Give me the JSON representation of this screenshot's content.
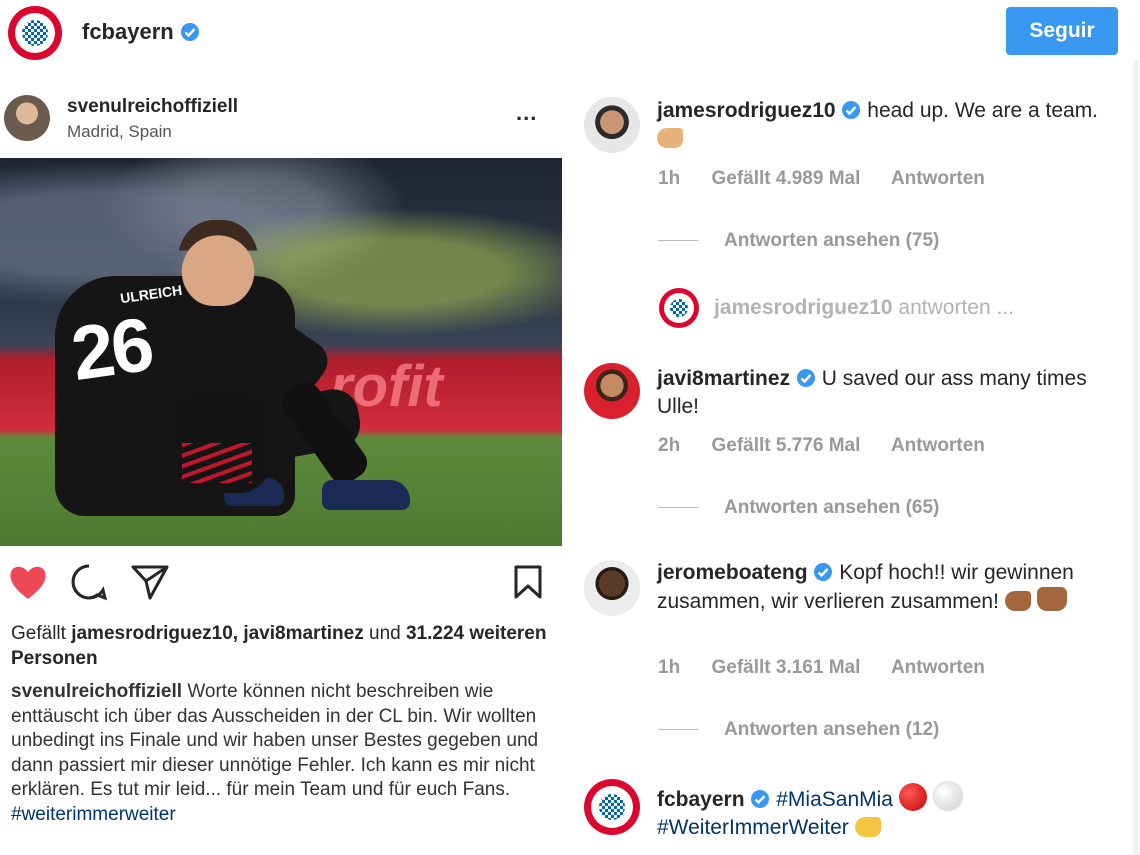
{
  "header": {
    "account": "fcbayern",
    "follow_label": "Seguir"
  },
  "post": {
    "author": "svenulreichoffiziell",
    "location": "Madrid, Spain",
    "more_label": "...",
    "photo": {
      "jersey_name": "ULREICH",
      "jersey_number": "26"
    },
    "likes_prefix": "Gefällt",
    "likes_names": "jamesrodriguez10, javi8martinez",
    "likes_and": "und",
    "likes_count": "31.224",
    "likes_suffix": "weiteren Personen",
    "caption_author": "svenulreichoffiziell",
    "caption_text": "Worte können nicht beschreiben wie enttäuscht ich über das Ausscheiden in der CL bin. Wir wollten unbedingt ins Finale und wir haben unser Bestes gegeben und dann passiert mir dieser unnötige Fehler. Ich kann es mir nicht erklären. Es tut mir leid... für mein Team und für euch Fans.",
    "caption_hashtag": "#weiterimmerweiter"
  },
  "comments": [
    {
      "user": "jamesrodriguez10",
      "text": "head up. We are a team.",
      "time": "1h",
      "likes": "Gefällt 4.989 Mal",
      "reply": "Antworten",
      "view_replies": "Antworten ansehen (75)"
    },
    {
      "user": "javi8martinez",
      "text": "U saved our ass many times Ulle!",
      "time": "2h",
      "likes": "Gefällt 5.776 Mal",
      "reply": "Antworten",
      "view_replies": "Antworten ansehen (65)"
    },
    {
      "user": "jeromeboateng",
      "text": "Kopf hoch!! wir gewinnen zusammen, wir verlieren zusammen!",
      "time": "1h",
      "likes": "Gefällt 3.161 Mal",
      "reply": "Antworten",
      "view_replies": "Antworten ansehen (12)"
    },
    {
      "user": "fcbayern",
      "text1": "#MiaSanMia",
      "text2": "#WeiterImmerWeiter"
    }
  ],
  "reply_box": {
    "placeholder_user": "jamesrodriguez10",
    "placeholder_suffix": "antworten ..."
  },
  "icons": {
    "like": "heart-icon",
    "comment": "comment-icon",
    "share": "share-icon",
    "save": "bookmark-icon",
    "verified": "verified-badge-icon"
  },
  "colors": {
    "accent": "#3897f0",
    "like": "#ed4956",
    "verified": "#3897f0"
  }
}
